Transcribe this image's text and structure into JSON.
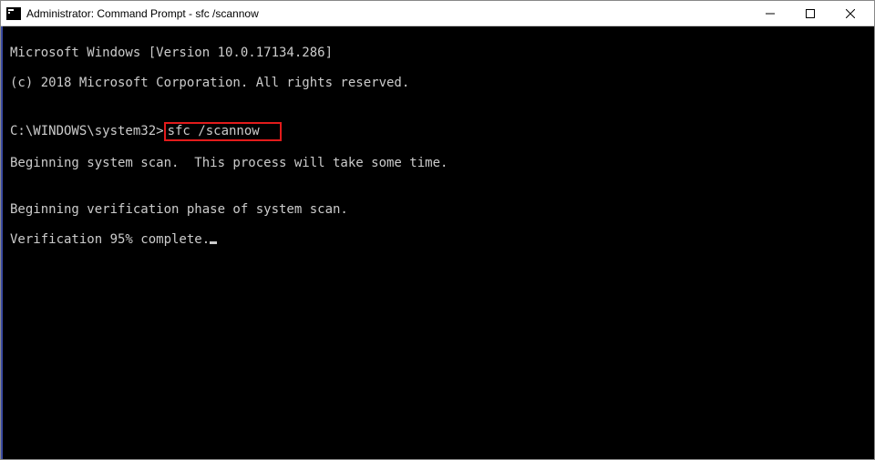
{
  "titlebar": {
    "title": "Administrator: Command Prompt - sfc  /scannow"
  },
  "console": {
    "line1": "Microsoft Windows [Version 10.0.17134.286]",
    "line2": "(c) 2018 Microsoft Corporation. All rights reserved.",
    "blank1": "",
    "prompt": "C:\\WINDOWS\\system32>",
    "command": "sfc /scannow",
    "blank2": "",
    "line3": "Beginning system scan.  This process will take some time.",
    "blank3": "",
    "line4": "Beginning verification phase of system scan.",
    "line5": "Verification 95% complete."
  }
}
